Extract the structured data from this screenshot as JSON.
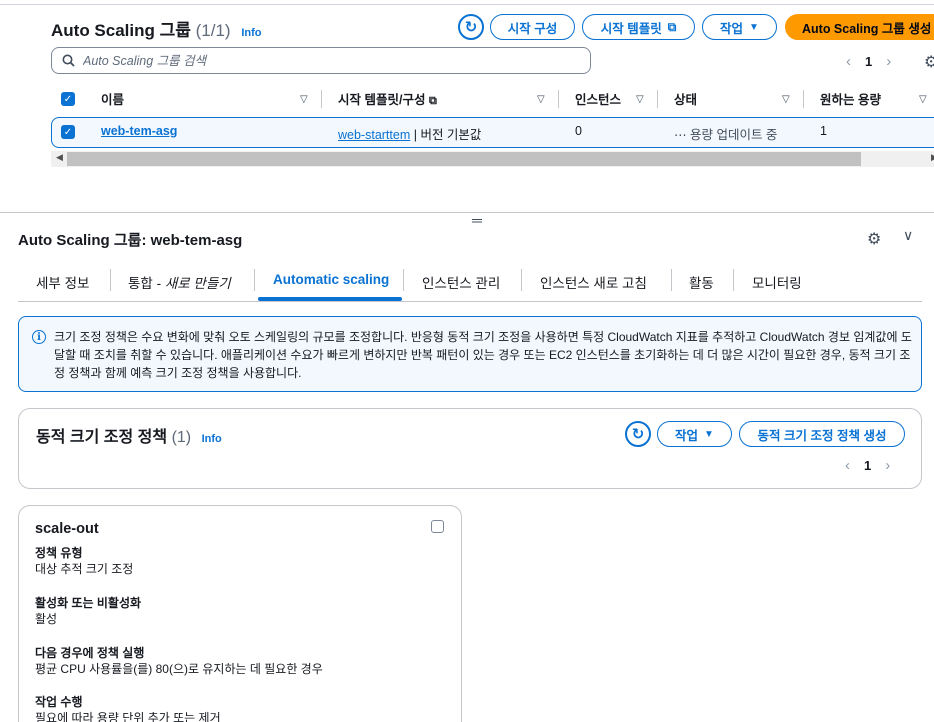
{
  "list": {
    "title": "Auto Scaling 그룹",
    "count": "(1/1)",
    "info": "Info",
    "refresh_icon": "refresh-icon",
    "buttons": {
      "launch_config": "시작 구성",
      "launch_template": "시작 템플릿",
      "actions": "작업",
      "create": "Auto Scaling 그룹 생성"
    },
    "search_placeholder": "Auto Scaling 그룹 검색",
    "page": "1",
    "columns": [
      "이름",
      "시작 템플릿/구성",
      "인스턴스",
      "상태",
      "원하는 용량"
    ],
    "rows": [
      {
        "name": "web-tem-asg",
        "template": "web-starttem",
        "template_suffix": " | 버전 기본값",
        "instances": "0",
        "status": "용량 업데이트 중",
        "desired": "1"
      }
    ]
  },
  "detail": {
    "title": "Auto Scaling 그룹: web-tem-asg",
    "tabs": [
      "세부 정보",
      "통합 - ",
      "새로 만들기",
      "Automatic scaling",
      "인스턴스 관리",
      "인스턴스 새로 고침",
      "활동",
      "모니터링"
    ],
    "alert": "크기 조정 정책은 수요 변화에 맞춰 오토 스케일링의 규모를 조정합니다. 반응형 동적 크기 조정을 사용하면 특정 CloudWatch 지표를 추적하고 CloudWatch 경보 임계값에 도달할 때 조치를 취할 수 있습니다. 애플리케이션 수요가 빠르게 변하지만 반복 패턴이 있는 경우 또는 EC2 인스턴스를 초기화하는 데 더 많은 시간이 필요한 경우, 동적 크기 조정 정책과 함께 예측 크기 조정 정책을 사용합니다.",
    "policies": {
      "title": "동적 크기 조정 정책",
      "count": "(1)",
      "info": "Info",
      "actions": "작업",
      "create": "동적 크기 조정 정책 생성",
      "page": "1"
    },
    "card": {
      "title": "scale-out",
      "fields": [
        {
          "label": "정책 유형",
          "value": "대상 추적 크기 조정"
        },
        {
          "label": "활성화 또는 비활성화",
          "value": "활성"
        },
        {
          "label": "다음 경우에 정책 실행",
          "value": "평균 CPU 사용률을(를) 80(으)로 유지하는 데 필요한 경우"
        },
        {
          "label": "작업 수행",
          "value": "필요에 따라 용량 단위 추가 또는 제거"
        }
      ]
    }
  },
  "colors": {
    "accent": "#0972d3",
    "primary_button": "#ff9900",
    "alert_bg": "#f2f8fd"
  }
}
